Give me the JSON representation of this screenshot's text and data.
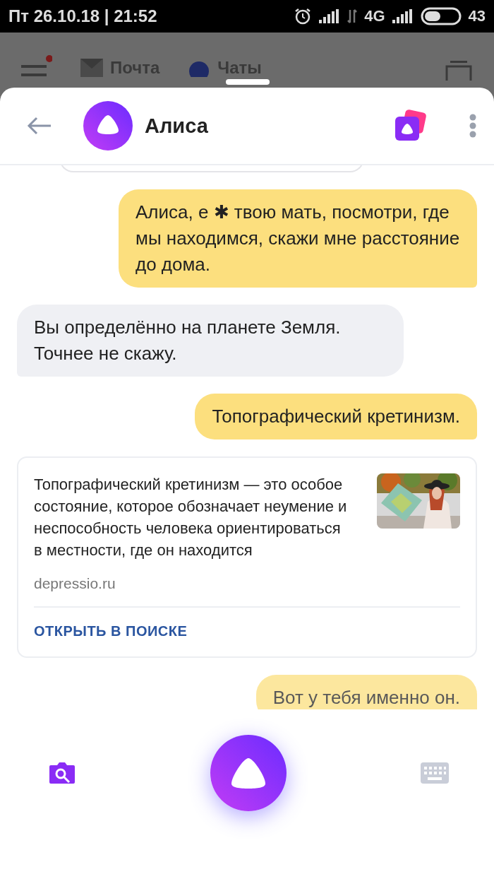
{
  "status_bar": {
    "datetime": "Пт 26.10.18 | 21:52",
    "network": "4G",
    "battery": "43"
  },
  "background_app": {
    "tabs": [
      {
        "label": "Почта"
      },
      {
        "label": "Чаты"
      }
    ]
  },
  "header": {
    "title": "Алиса"
  },
  "messages": [
    {
      "kind": "user",
      "text": "Алиса, е ✱ твою мать, посмотри, где мы находимся, скажи мне расстояние до дома."
    },
    {
      "kind": "assistant",
      "text": "Вы определённо на планете Земля. Точнее не скажу."
    },
    {
      "kind": "user",
      "text": "Топографический кретинизм."
    },
    {
      "kind": "card",
      "text": "Топографический кретинизм — это особое состояние, которое обозначает неумение и неспособность человека ориентироваться в местности, где он находится",
      "source": "depressio.ru",
      "action": "ОТКРЫТЬ В ПОИСКЕ"
    },
    {
      "kind": "user",
      "text": "Вот у тебя именно он.",
      "faded": true
    }
  ]
}
